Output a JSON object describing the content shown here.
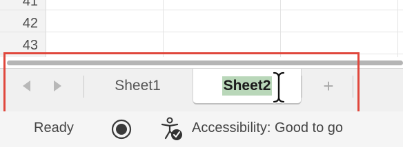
{
  "grid": {
    "rows": [
      {
        "number": "41"
      },
      {
        "number": "42"
      },
      {
        "number": "43"
      }
    ]
  },
  "tabs": {
    "items": [
      {
        "label": "Sheet1",
        "active": false
      },
      {
        "label": "Sheet2",
        "active": true
      }
    ],
    "prev_icon": "chevron-left-icon",
    "next_icon": "chevron-right-icon",
    "add_label": "+"
  },
  "status": {
    "ready": "Ready",
    "recording_icon": "record-macro-icon",
    "accessibility_icon": "accessibility-icon",
    "accessibility": "Accessibility: Good to go"
  },
  "colors": {
    "highlight_border": "#e0473c",
    "active_tab_text_bg": "#b9d7b9"
  }
}
